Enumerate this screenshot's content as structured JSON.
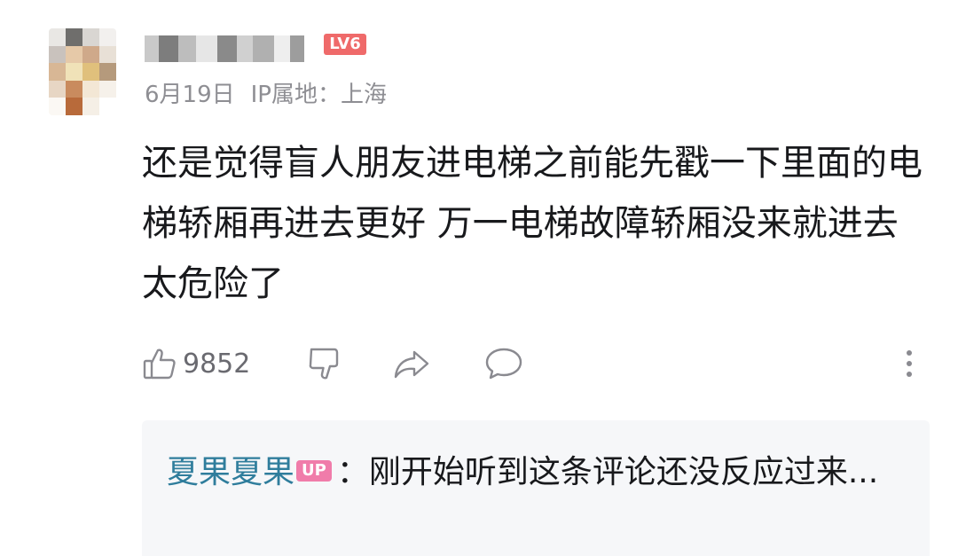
{
  "comment": {
    "level_badge": "LV6",
    "date": "6月19日",
    "ip_location": "IP属地：上海",
    "text": "还是觉得盲人朋友进电梯之前能先戳一下里面的电梯轿厢再进去更好 万一电梯故障轿厢没来就进去太危险了",
    "like_count": "9852"
  },
  "reply": {
    "user": "夏果夏果",
    "badge": "UP",
    "text": "：刚开始听到这条评论还没反应过来..."
  },
  "colors": {
    "level_badge": "#ef6a6a",
    "up_badge": "#f07caa",
    "reply_user": "#2f7d9c",
    "meta_text": "#8e8e93"
  },
  "icons": {
    "like": "thumbs-up-icon",
    "dislike": "thumbs-down-icon",
    "share": "share-icon",
    "reply": "reply-bubble-icon",
    "more": "more-vertical-icon"
  }
}
